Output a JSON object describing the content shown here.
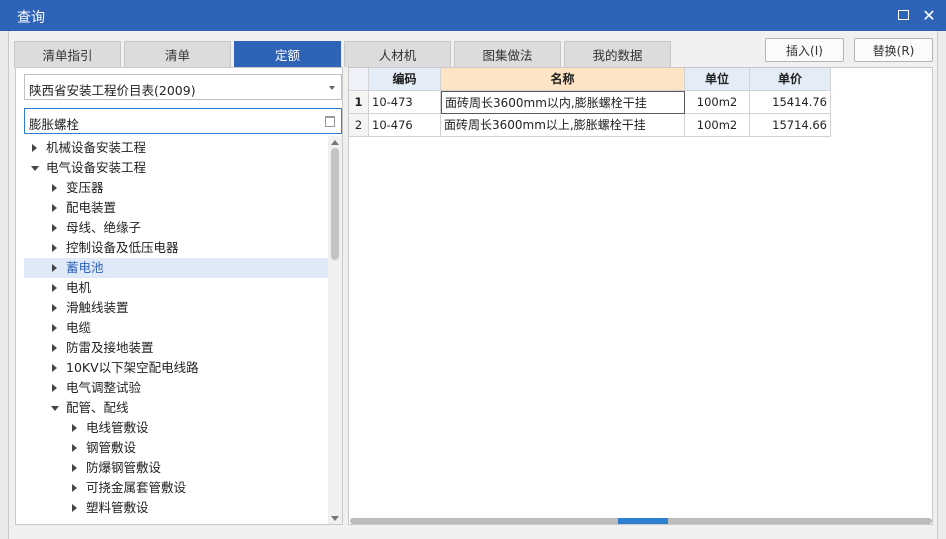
{
  "window": {
    "title": "查询"
  },
  "tabs": [
    {
      "label": "清单指引",
      "active": false
    },
    {
      "label": "清单",
      "active": false
    },
    {
      "label": "定额",
      "active": true
    },
    {
      "label": "人材机",
      "active": false
    },
    {
      "label": "图集做法",
      "active": false
    },
    {
      "label": "我的数据",
      "active": false
    }
  ],
  "actions": {
    "insert_label": "插入(I)",
    "replace_label": "替换(R)"
  },
  "library": {
    "selected": "陕西省安装工程价目表(2009)"
  },
  "search": {
    "value": "膨胀螺栓"
  },
  "tree": [
    {
      "label": "机械设备安装工程",
      "level": 0,
      "state": "closed",
      "selected": false
    },
    {
      "label": "电气设备安装工程",
      "level": 0,
      "state": "open",
      "selected": false
    },
    {
      "label": "变压器",
      "level": 1,
      "state": "closed",
      "selected": false
    },
    {
      "label": "配电装置",
      "level": 1,
      "state": "closed",
      "selected": false
    },
    {
      "label": "母线、绝缘子",
      "level": 1,
      "state": "closed",
      "selected": false
    },
    {
      "label": "控制设备及低压电器",
      "level": 1,
      "state": "closed",
      "selected": false
    },
    {
      "label": "蓄电池",
      "level": 1,
      "state": "closed",
      "selected": true
    },
    {
      "label": "电机",
      "level": 1,
      "state": "closed",
      "selected": false
    },
    {
      "label": "滑触线装置",
      "level": 1,
      "state": "closed",
      "selected": false
    },
    {
      "label": "电缆",
      "level": 1,
      "state": "closed",
      "selected": false
    },
    {
      "label": "防雷及接地装置",
      "level": 1,
      "state": "closed",
      "selected": false
    },
    {
      "label": "10KV以下架空配电线路",
      "level": 1,
      "state": "closed",
      "selected": false
    },
    {
      "label": "电气调整试验",
      "level": 1,
      "state": "closed",
      "selected": false
    },
    {
      "label": "配管、配线",
      "level": 1,
      "state": "open",
      "selected": false
    },
    {
      "label": "电线管敷设",
      "level": 2,
      "state": "closed",
      "selected": false
    },
    {
      "label": "钢管敷设",
      "level": 2,
      "state": "closed",
      "selected": false
    },
    {
      "label": "防爆钢管敷设",
      "level": 2,
      "state": "closed",
      "selected": false
    },
    {
      "label": "可挠金属套管敷设",
      "level": 2,
      "state": "closed",
      "selected": false
    },
    {
      "label": "塑料管敷设",
      "level": 2,
      "state": "closed",
      "selected": false
    }
  ],
  "grid": {
    "headers": {
      "code": "编码",
      "name": "名称",
      "unit": "单位",
      "price": "单价"
    },
    "rows": [
      {
        "num": "1",
        "code": "10-473",
        "name": "面砖周长3600mm以内,膨胀螺栓干挂",
        "unit": "100m2",
        "price": "15414.76"
      },
      {
        "num": "2",
        "code": "10-476",
        "name": "面砖周长3600mm以上,膨胀螺栓干挂",
        "unit": "100m2",
        "price": "15714.66"
      }
    ]
  },
  "colors": {
    "accent": "#2f63b8",
    "header_bg": "#e4edf7",
    "header_highlight": "#fce4c4",
    "selection_bg": "#dfe9f8"
  }
}
